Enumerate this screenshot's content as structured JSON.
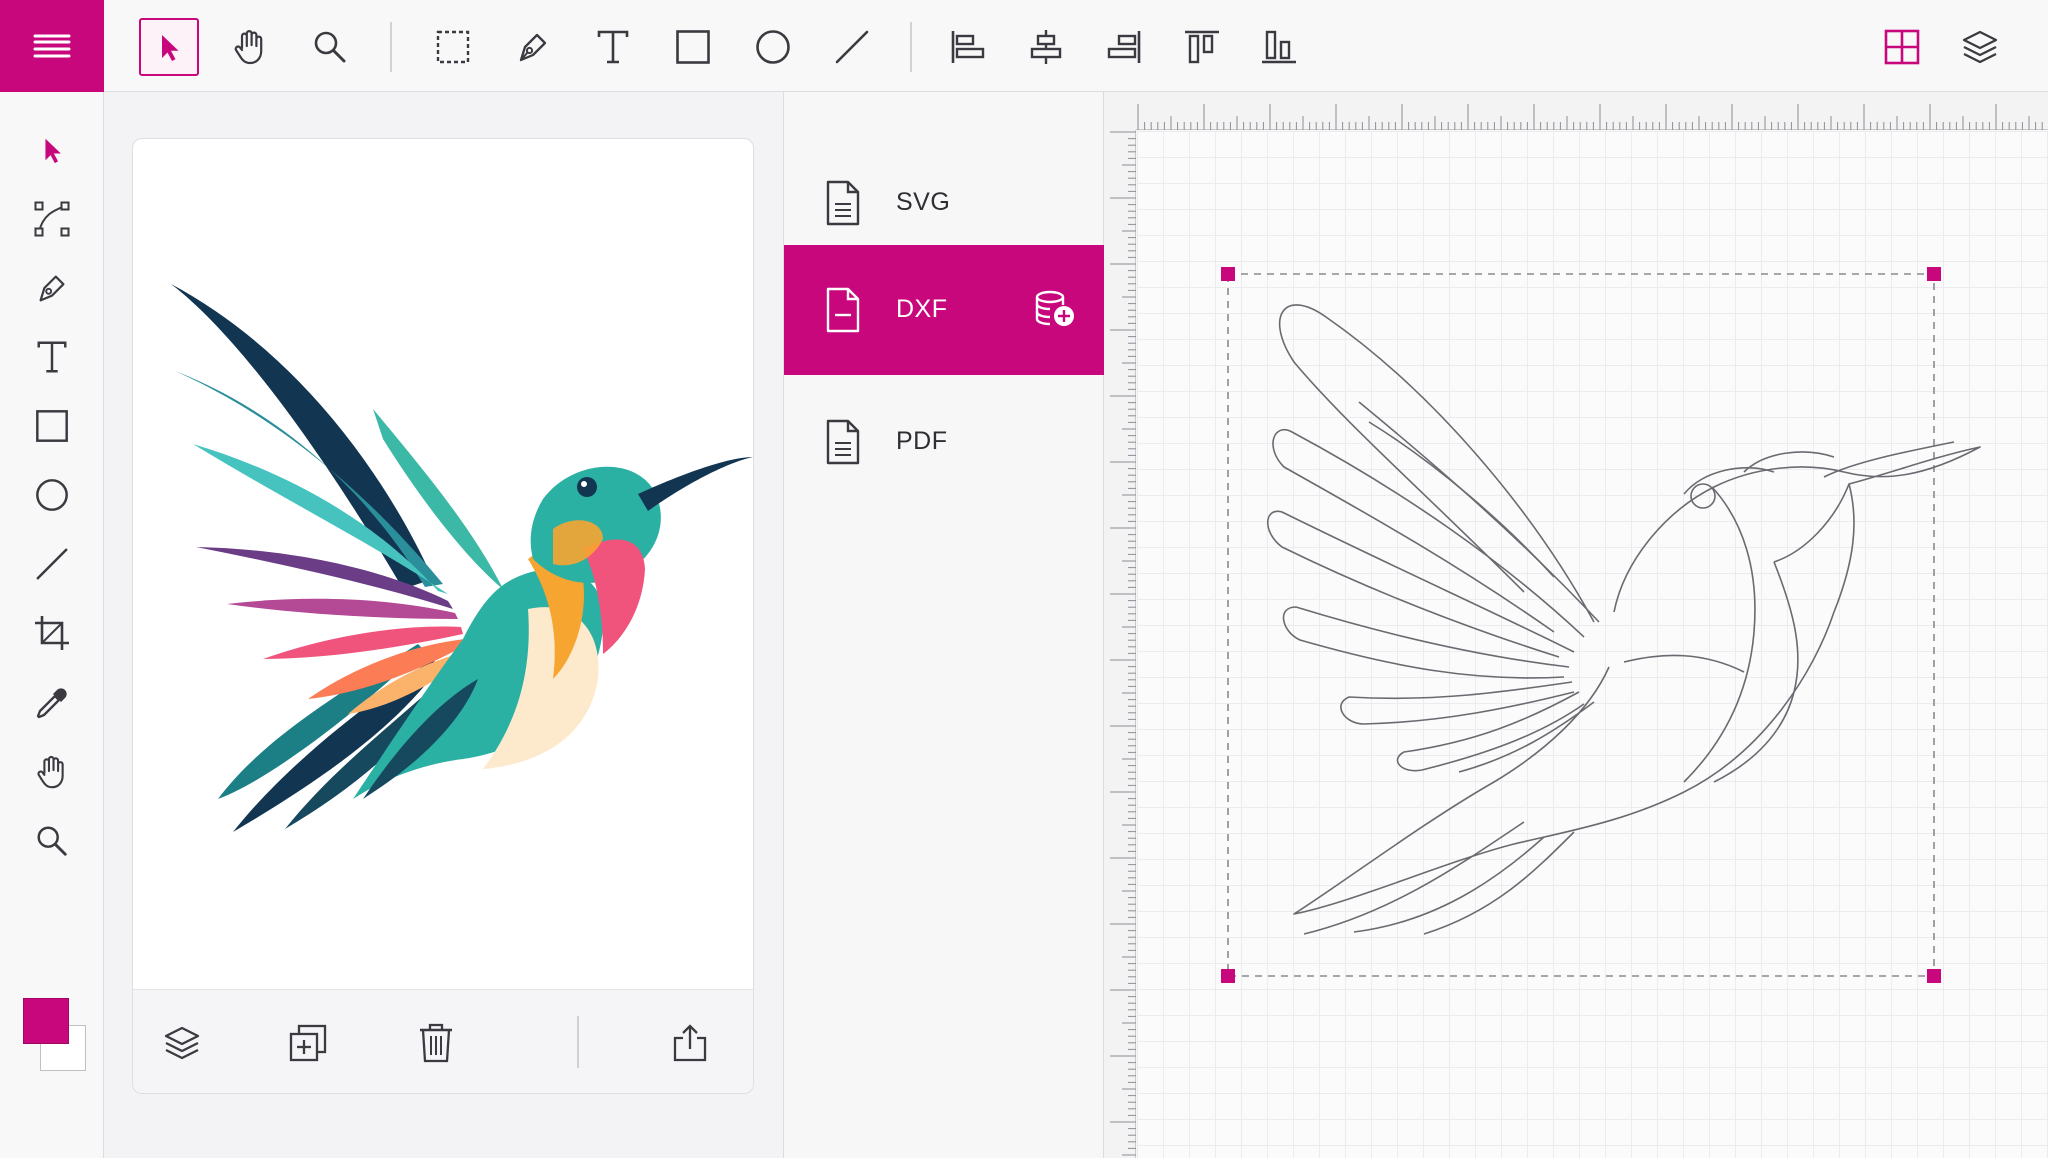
{
  "app": {
    "accent": "#c8077c"
  },
  "toolbar": {
    "icons": [
      "menu-icon",
      "select-arrow-icon",
      "hand-pan-icon",
      "zoom-icon",
      "marquee-select-icon",
      "pen-icon",
      "text-icon",
      "rectangle-icon",
      "ellipse-icon",
      "line-icon",
      "align-left-icon",
      "align-center-icon",
      "align-right-icon",
      "align-top-icon",
      "align-bottom-icon",
      "grid-view-icon",
      "layers-icon"
    ],
    "active_tool": "select"
  },
  "tool_rail": {
    "icons": [
      "select-arrow-icon",
      "node-edit-icon",
      "pen-icon",
      "text-icon",
      "rectangle-icon",
      "ellipse-icon",
      "line-icon",
      "crop-icon",
      "eyedropper-icon",
      "hand-pan-icon",
      "zoom-icon"
    ],
    "fill_color": "#c8077c",
    "stroke_color": "#ffffff"
  },
  "preview_panel": {
    "footer_icons": [
      "layers-icon",
      "duplicate-icon",
      "trash-icon",
      "export-share-icon"
    ]
  },
  "formats": {
    "items": [
      {
        "label": "SVG",
        "selected": false
      },
      {
        "label": "DXF",
        "selected": true
      },
      {
        "label": "PDF",
        "selected": false
      }
    ]
  }
}
